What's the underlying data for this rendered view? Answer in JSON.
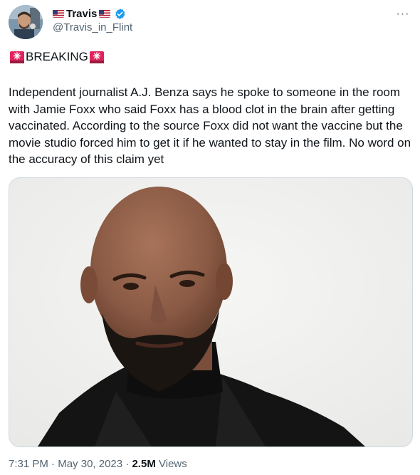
{
  "tweet": {
    "author": {
      "display_name": "Travis",
      "handle": "@Travis_in_Flint",
      "flag_icon": "us-flag-icon",
      "verified_icon": "verified-badge-icon",
      "verified_color": "#1d9bf0"
    },
    "more_label": "···",
    "breaking_label": "BREAKING",
    "siren_icon": "siren-icon",
    "text": "Independent journalist A.J. Benza says he spoke to someone in the room with Jamie Foxx who said Foxx has a blood clot in the brain after getting vaccinated.  According to the source Foxx did not want the vaccine but the movie studio forced him to get it if he wanted to stay in the film.  No word on the accuracy of this claim yet",
    "meta": {
      "time": "7:31 PM",
      "separator": "·",
      "date": "May 30, 2023",
      "views_count": "2.5M",
      "views_label": "Views"
    }
  },
  "colors": {
    "text_primary": "#0f1419",
    "text_secondary": "#536471",
    "border": "#cfd9de",
    "siren_red": "#e0245e"
  }
}
